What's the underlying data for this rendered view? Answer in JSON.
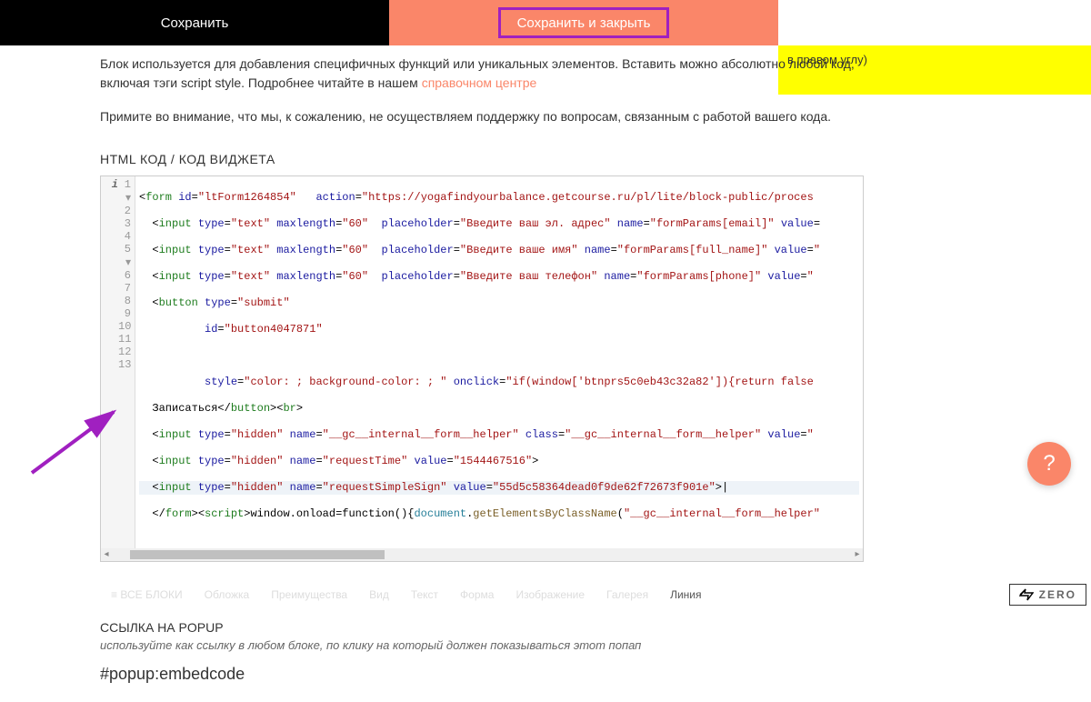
{
  "toolbar": {
    "save": "Сохранить",
    "save_close": "Сохранить и закрыть"
  },
  "yellow_note": "в правом углу)",
  "description": {
    "p1a": "Блок используется для добавления специфичных функций или уникальных элементов. Вставить можно абсолютно любой код, включая тэги script style. Подробнее читайте в нашем ",
    "p1link": "справочном центре",
    "p2": "Примите во внимание, что мы, к сожалению, не осуществляем поддержку по вопросам, связанным с работой вашего кода."
  },
  "section_html_label": "HTML КОД / КОД ВИДЖЕТА",
  "code": {
    "info_icon": "i",
    "lines": {
      "l1": "1",
      "l2": "2",
      "l3": "3",
      "l4": "4",
      "l5": "5",
      "l6": "6",
      "l7": "7",
      "l8": "8",
      "l9": "9",
      "l10": "10",
      "l11": "11",
      "l12": "12",
      "l13": "13"
    },
    "c1_form_id": "ltForm1264854",
    "c1_action": "https://yogafindyourbalance.getcourse.ru/pl/lite/block-public/proces",
    "c2_maxlength": "60",
    "c2_placeholder": "Введите ваш эл. адрес",
    "c2_name": "formParams[email]",
    "c3_placeholder": "Введите ваше имя",
    "c3_name": "formParams[full_name]",
    "c4_placeholder": "Введите ваш телефон",
    "c4_name": "formParams[phone]",
    "c5_type": "submit",
    "c6_id": "button4047871",
    "c8_style": "color: ; background-color: ; ",
    "c8_onclick": "if(window['btnprs5c0eb43c32a82']){return false",
    "c9_text": "Записаться",
    "c10_name": "__gc__internal__form__helper",
    "c11_name": "requestTime",
    "c11_value": "1544467516",
    "c12_name": "requestSimpleSign",
    "c12_value": "55d5c58364dead0f9de62f72673f901e",
    "c13_class": "__gc__internal__form__helper"
  },
  "menubar": {
    "all_blocks": "ВСЕ БЛОКИ",
    "items": [
      "Обложка",
      "Преимущества",
      "Вид",
      "Текст",
      "Форма",
      "Изображение",
      "Галерея"
    ],
    "last": "Линия",
    "zero": "ZERO"
  },
  "popup": {
    "title": "ССЫЛКА НА POPUP",
    "hint": "используйте как ссылку в любом блоке, по клику на который должен показываться этот попап",
    "code": "#popup:embedcode"
  },
  "help": "?"
}
